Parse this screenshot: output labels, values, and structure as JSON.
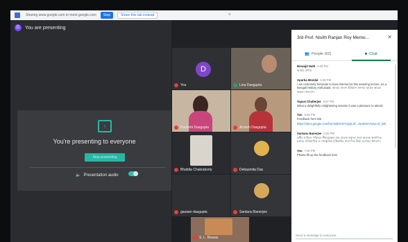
{
  "share_bar": {
    "text": "Sharing www.google.com to meet.google.com",
    "stop_label": "Stop",
    "share_tab_label": "Share this tab instead"
  },
  "presenter": {
    "avatar_initial": "D",
    "status": "You are presenting",
    "card_title": "You're presenting to everyone",
    "stop_button": "Stop presenting",
    "audio_label": "Presentation audio"
  },
  "tiles": [
    {
      "name": "You",
      "avatar": "D"
    },
    {
      "name": "Lina Dasgupta"
    },
    {
      "name": "Poulomi Dasgupta"
    },
    {
      "name": "Arnesh Dasgupta"
    },
    {
      "name": "Bhabita Chakraborty"
    },
    {
      "name": "Debasmita Das"
    },
    {
      "name": "gautam dasgupta"
    },
    {
      "name": "Santanu Banerjee"
    },
    {
      "name": "S. L. Biswas"
    }
  ],
  "panel": {
    "title": "3rd Prof. Nisith Ranjan Roy Memo...",
    "tabs": [
      {
        "label": "People (62)"
      },
      {
        "label": "Chat"
      }
    ],
    "messages": [
      {
        "author": "Biswajit Nath",
        "time": "6:36 PM",
        "text": "আমার প্রণাম"
      },
      {
        "author": "Apurba Mondal",
        "time": "6:38 PM",
        "text": "I am extremely fortunate to have listened to this amazing lecture, as a Bengali History enthusiast. আমার বাংলা ইতিহাস জানার আগ্রহ আরো বাড়ল। ধন্যবাদ।"
      },
      {
        "author": "Tapasi Chatterjee",
        "time": "6:57 PM",
        "text": "What a delightfully enlightening session it was a pleasure to attend."
      },
      {
        "author": "You",
        "time": "6:59 PM",
        "text": "Feedback form link",
        "link": "https://docs.google.com/forms/d/e/1FAIpQLSf...viewform?usp=sf_link"
      },
      {
        "author": "Santanu Banerjee",
        "time": "6:59 PM",
        "text": "বঙ্গীয় সাহিত্য পরিষদে নীহাররঞ্জন রায় স্মারক বক্তৃতা শুনে অত্যন্ত আনন্দিত হলাম। ঐতিহাসিক ও সাংস্কৃতিক দৃষ্টিভঙ্গির নানা দিক উঠে এসেছে। ধন্যবাদ।"
      },
      {
        "author": "You",
        "time": "7:00 PM",
        "text": "Please fill up the feedback form"
      }
    ],
    "input_placeholder": "Send a message to everyone"
  }
}
